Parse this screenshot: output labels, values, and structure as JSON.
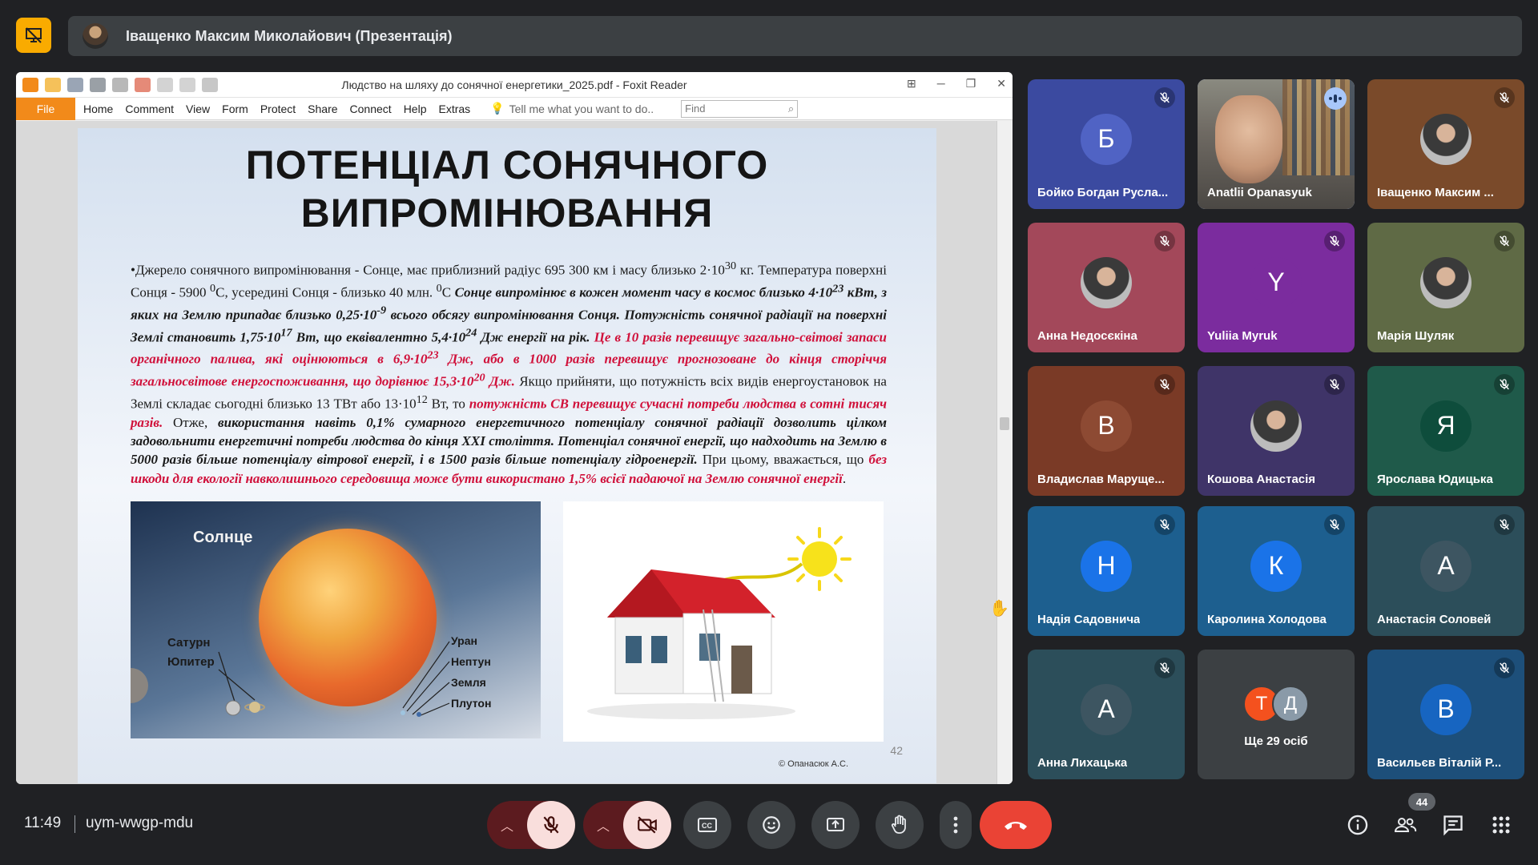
{
  "presentation_banner": {
    "title": "Іващенко Максим Миколайович (Презентація)"
  },
  "foxit": {
    "window_title": "Людство на шляху до сонячної енергетики_2025.pdf - Foxit Reader",
    "menu": {
      "file": "File",
      "items": [
        "Home",
        "Comment",
        "View",
        "Form",
        "Protect",
        "Share",
        "Connect",
        "Help",
        "Extras"
      ],
      "tell_me": "Tell me what you want to do..",
      "find_placeholder": "Find"
    }
  },
  "slide": {
    "title_line1": "ПОТЕНЦІАЛ СОНЯЧНОГО",
    "title_line2": "ВИПРОМІНЮВАННЯ",
    "p1_plain": "•Джерело сонячного випромінювання - Сонце, має приблизний радіус 695 300 км і масу близько 2·10",
    "p1_exp": "30",
    "p1_unit": " кг. Температура поверхні Сонця - 5900 ",
    "p1_deg": "0",
    "p1_mid": "С, усередині Сонця - близько 40 млн. ",
    "p1_deg2": "0",
    "p1_c": "С ",
    "b1": "Сонце випромінює в кожен момент часу в космос близько 4·10",
    "b1_exp": "23",
    "b1b": " кВт, з яких на Землю припадає близько 0,25·10",
    "b1b_exp": "-9",
    "b1c": " всього обсягу випромінювання Сонця. Потужність сонячної радіації на поверхні Землі становить 1,75·10",
    "b1c_exp": "17",
    "b1d": " Вт, що еквівалентно 5,4·10",
    "b1d_exp": "24",
    "b1e": " Дж енергії на рік.",
    "r1": " Це в 10 разів перевищує загально-світові запаси органічного палива, які оцінюються в 6,9·10",
    "r1_exp": "23",
    "r1b": " Дж, або в 1000 разів перевищує прогнозоване до кінця сторіччя загальносвітове енергоспоживання, що дорівнює 15,3·10",
    "r1b_exp": "20",
    "r1c": " Дж.",
    "p2": " Якщо прийняти, що потужність всіх видів енергоустановок на Землі складає сьогодні близько 13 ТВт  або 13·10",
    "p2_exp": "12",
    "p2b": " Вт, то ",
    "r2": "потужність СВ перевищує сучасні потреби людства в сотні тисяч разів.",
    "p3": " Отже, ",
    "b3": "використання навіть 0,1% сумарного енергетичного потенціалу сонячної радіації дозволить цілком задовольнити енергетичні потреби людства до кінця XXI століття. Потенціал сонячної енергії, що надходить на Землю в 5000 разів більше потенціалу вітрової енергії, і в 1500 разів більше потенціалу гідроенергії.",
    "p4": " При цьому, вважається, що ",
    "r4": "без шкоди для екології навколишнього середовища може бути використано 1,5% всієї падаючої на Землю сонячної енергії",
    "p4_end": ".",
    "img_labels": {
      "sun": "Солнце",
      "saturn": "Сатурн",
      "jupiter": "Юпитер",
      "uranus": "Уран",
      "neptune": "Нептун",
      "earth": "Земля",
      "pluto": "Плутон"
    },
    "page_number": "42",
    "author": "© Опанасюк А.С."
  },
  "participants": [
    {
      "name": "Бойко Богдан Русла...",
      "initial": "Б",
      "bg": "#3b4aa0",
      "av": "#5063c4",
      "muted": true
    },
    {
      "name": "Anatlii Opanasyuk",
      "initial": "",
      "bg": "#6f6a63",
      "av": "",
      "muted": false,
      "speaking": true
    },
    {
      "name": "Іващенко Максим ...",
      "initial": "",
      "bg": "#7a4a2a",
      "av": "",
      "muted": true
    },
    {
      "name": "Анна Недосєкіна",
      "initial": "",
      "bg": "#a3485a",
      "av": "",
      "muted": true
    },
    {
      "name": "Yuliia Myruk",
      "initial": "Y",
      "bg": "#7b2c9e",
      "av": "#7b2c9e",
      "muted": true
    },
    {
      "name": "Марія Шуляк",
      "initial": "",
      "bg": "#5f6a45",
      "av": "",
      "muted": true
    },
    {
      "name": "Владислав Маруще...",
      "initial": "В",
      "bg": "#7a3a26",
      "av": "#8d4a33",
      "muted": true
    },
    {
      "name": "Кошова Анастасія",
      "initial": "",
      "bg": "#3f3468",
      "av": "",
      "muted": true
    },
    {
      "name": "Ярослава Юдицька",
      "initial": "Я",
      "bg": "#1f5a4a",
      "av": "#0e4d3c",
      "muted": true
    },
    {
      "name": "Надія Садовнича",
      "initial": "Н",
      "bg": "#1d5f8f",
      "av": "#1a73e8",
      "muted": true
    },
    {
      "name": "Каролина Холодова",
      "initial": "К",
      "bg": "#1d5f8f",
      "av": "#1a73e8",
      "muted": true
    },
    {
      "name": "Анастасія Соловей",
      "initial": "А",
      "bg": "#2c4e5a",
      "av": "#3d5561",
      "muted": true
    },
    {
      "name": "Анна Лихацька",
      "initial": "А",
      "bg": "#2c4e5a",
      "av": "#3d5561",
      "muted": true
    },
    {
      "name": "Васильєв Віталій Р...",
      "initial": "В",
      "bg": "#1d4f7a",
      "av": "#1765c1",
      "muted": true
    }
  ],
  "more_tile": {
    "text": "Ще 29 осіб",
    "a1": "Т",
    "a2": "Д"
  },
  "bottom_bar": {
    "time": "11:49",
    "meeting_code": "uym-wwgp-mdu",
    "participants_count": "44"
  },
  "colors": {
    "background": "#202124",
    "banner": "#3c4043",
    "pin": "#f9ab00",
    "end_call": "#ea4335",
    "foxit_accent": "#f28a1a"
  }
}
